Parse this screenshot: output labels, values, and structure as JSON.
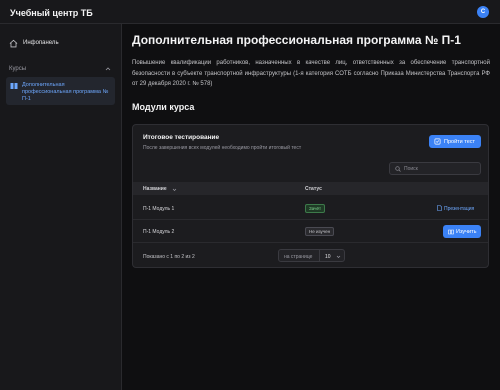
{
  "app": {
    "title": "Учебный центр ТБ",
    "avatar_letter": "С"
  },
  "sidebar": {
    "home_label": "Инфопанель",
    "section_label": "Курсы",
    "course_item_label": "Дополнительная профессиональная программа № П-1"
  },
  "page": {
    "title": "Дополнительная профессиональная программа № П-1",
    "description": "Повышение квалификации работников, назначенных в качестве лиц, ответственных за обеспечение транспортной безопасности в субъекте транспортной инфраструктуры (1-я категория СОТБ согласно Приказа Министерства Транспорта РФ от 29 декабря 2020 г. № 578)",
    "modules_heading": "Модули курса"
  },
  "final_test": {
    "title": "Итоговое тестирование",
    "subtitle": "После завершения всех модулей необходимо пройти итоговый тест",
    "button_label": "Пройти тест"
  },
  "search": {
    "placeholder": "Поиск"
  },
  "table": {
    "columns": [
      "Название",
      "Статус"
    ],
    "rows": [
      {
        "name": "П-1 Модуль 1",
        "status": "Зачёт",
        "action": "Презентация"
      },
      {
        "name": "П-1 Модуль 2",
        "status": "Не изучен",
        "action": "Изучить"
      }
    ]
  },
  "pagination": {
    "info": "Показано с 1 по 2 из 2",
    "per_page_label": "на странице",
    "per_page_value": "10"
  },
  "colors": {
    "accent": "#3b82f6",
    "link": "#6ea8fe",
    "pass": "#7fd48f",
    "background": "#0f0f11"
  }
}
